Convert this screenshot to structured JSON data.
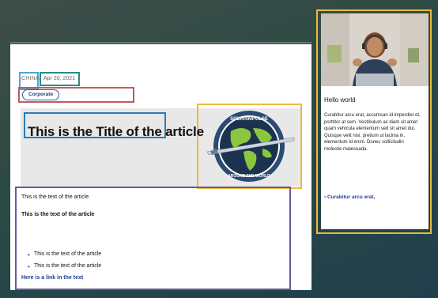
{
  "article": {
    "country": "CHINA",
    "date": "Apr 20, 2021",
    "tag": "Corporate",
    "title": "This is the Title of the article",
    "logo_top": "SOLARIMPULSE",
    "logo_bottom": "AROUND THE WORLD",
    "paragraph": "This is the text of the article",
    "paragraph_bold": "This is the text of the article",
    "list": [
      "This is the text of the article",
      "This is the text of the article"
    ],
    "link": "Here is a link in the text"
  },
  "sidebar": {
    "title": "Hello world",
    "body": "Curabitur arcu erat, accumsan id imperdiet et, porttitor at sem. Vestibulum ac diam sit amet quam vehicula elementum sed sit amet dui. Quisque velit nisi, pretium ut lacinia in, elementum id enim. Donec sollicitudin molestie malesuada.",
    "link": "Curabitur arcu erat,"
  },
  "colors": {
    "country_frame": "#4aa7d8",
    "date_frame": "#2a8a86",
    "tag_frame": "#c45b5b",
    "title_frame": "#2b7db8",
    "image_frame": "#eeb93a",
    "body_frame": "#6a5a9c",
    "link": "#1f3c9a"
  },
  "icons": {
    "logo": "solar-impulse-globe-logo",
    "link_arrow": "chevron-right-icon"
  }
}
